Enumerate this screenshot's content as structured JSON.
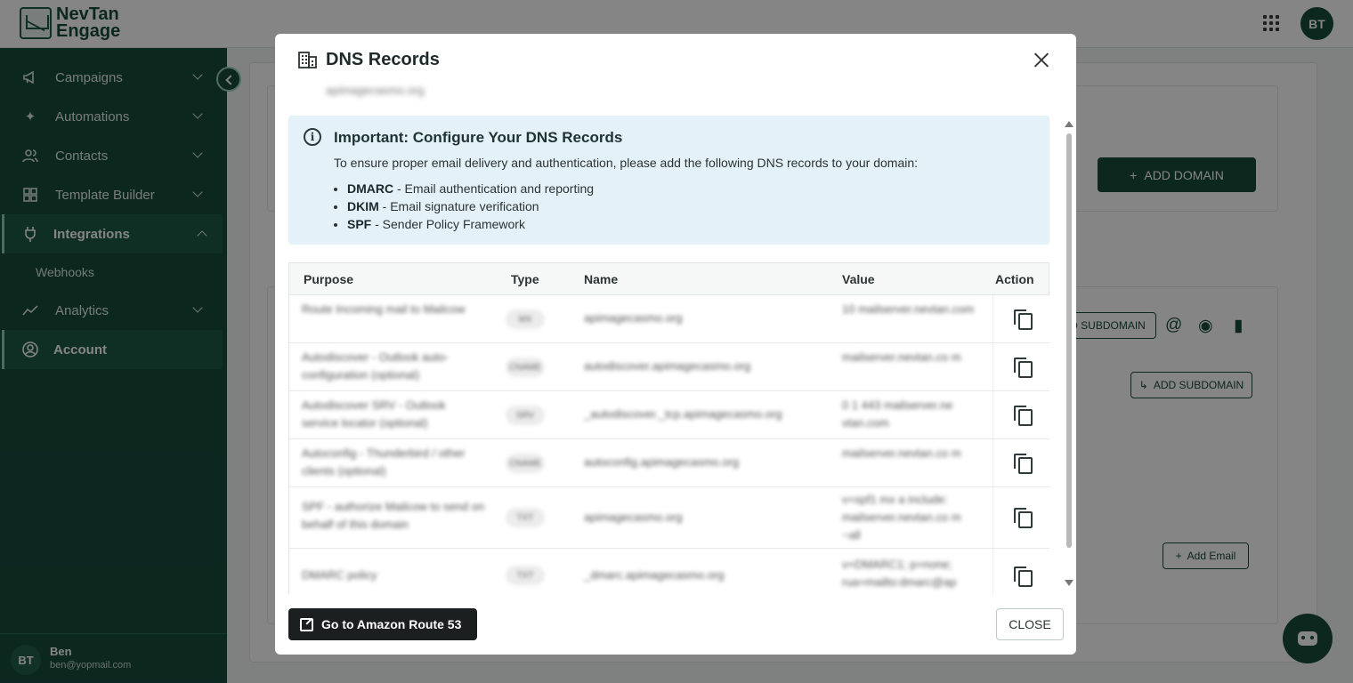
{
  "app": {
    "brand_line1": "NevTan",
    "brand_line2": "Engage",
    "user_initials": "BT"
  },
  "sidebar": {
    "items": [
      {
        "label": "Campaigns",
        "icon": "megaphone-icon"
      },
      {
        "label": "Automations",
        "icon": "sparkle-icon"
      },
      {
        "label": "Contacts",
        "icon": "contacts-icon"
      },
      {
        "label": "Template Builder",
        "icon": "grid-icon"
      },
      {
        "label": "Integrations",
        "icon": "plug-icon"
      },
      {
        "label": "Webhooks"
      },
      {
        "label": "Analytics",
        "icon": "trend-icon"
      },
      {
        "label": "Account",
        "icon": "account-icon"
      }
    ],
    "user": {
      "initials": "BT",
      "name": "Ben",
      "email": "ben@yopmail.com"
    }
  },
  "background": {
    "add_domain_label": "ADD DOMAIN",
    "add_subdomain_label": "ADD SUBDOMAIN",
    "add_subdomain_partial": "D SUBDOMAIN",
    "add_email_label": "Add Email"
  },
  "modal": {
    "title": "DNS Records",
    "domain": "apimagecasmo.org",
    "info": {
      "title": "Important: Configure Your DNS Records",
      "description": "To ensure proper email delivery and authentication, please add the following DNS records to your domain:",
      "items": [
        {
          "term": "DMARC",
          "text": " - Email authentication and reporting"
        },
        {
          "term": "DKIM",
          "text": " - Email signature verification"
        },
        {
          "term": "SPF",
          "text": " - Sender Policy Framework"
        }
      ]
    },
    "table": {
      "headers": {
        "purpose": "Purpose",
        "type": "Type",
        "name": "Name",
        "value": "Value",
        "action": "Action"
      },
      "rows": [
        {
          "purpose": "Route Incoming mail to Mailcow",
          "type": "MX",
          "name": "apimagecasmo.org",
          "value": "10 mailserver.nevtan.com"
        },
        {
          "purpose": "Autodiscover - Outlook auto-configuration (optional)",
          "type": "CNAME",
          "name": "autodiscover.apimagecasmo.org",
          "value": "mailserver.nevtan.co m"
        },
        {
          "purpose": "Autodiscover SRV - Outlook service locator (optional)",
          "type": "SRV",
          "name": "_autodiscover._tcp.apimagecasmo.org",
          "value": "0 1 443 mailserver.ne vtan.com"
        },
        {
          "purpose": "Autoconfig - Thunderbird / other clients (optional)",
          "type": "CNAME",
          "name": "autoconfig.apimagecasmo.org",
          "value": "mailserver.nevtan.co m"
        },
        {
          "purpose": "SPF - authorize Mailcow to send on behalf of this domain",
          "type": "TXT",
          "name": "apimagecasmo.org",
          "value": "v=spf1 mx a include: mailserver.nevtan.co m ~all"
        },
        {
          "purpose": "DMARC policy",
          "type": "TXT",
          "name": "_dmarc.apimagecasmo.org",
          "value": "v=DMARC1; p=none; rua=mailto:dmarc@ap"
        }
      ]
    },
    "route53_label": "Go to Amazon Route 53",
    "close_label": "CLOSE"
  }
}
